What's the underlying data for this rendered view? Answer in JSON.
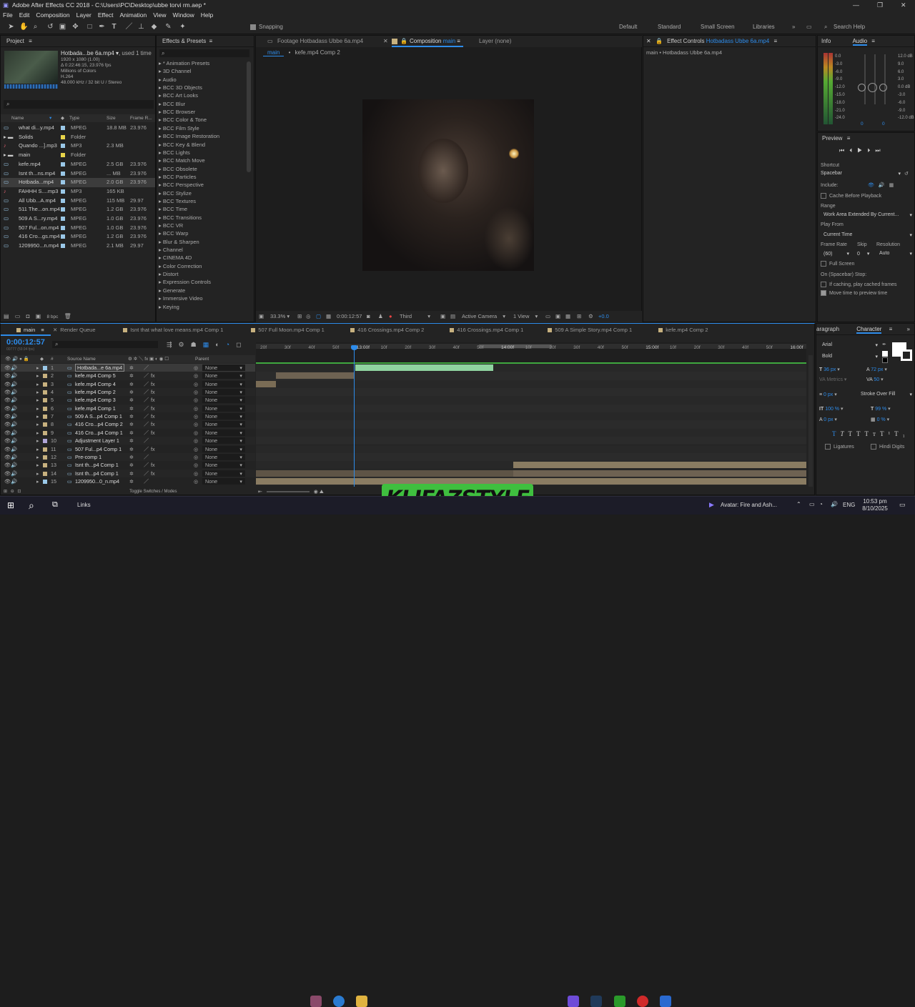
{
  "titlebar": {
    "title": "Adobe After Effects CC 2018 - C:\\Users\\PC\\Desktop\\ubbe torvi rm.aep *",
    "min": "—",
    "max": "❐",
    "close": "✕"
  },
  "menu": [
    "File",
    "Edit",
    "Composition",
    "Layer",
    "Effect",
    "Animation",
    "View",
    "Window",
    "Help"
  ],
  "toolbar": {
    "snapping": "Snapping",
    "workspaces": [
      "Default",
      "Standard",
      "Small Screen",
      "Libraries"
    ],
    "active_ws": "Standard",
    "search_placeholder": "Search Help"
  },
  "project": {
    "title": "Project",
    "info_name": "Hotbada...be 6a.mp4",
    "info_used": ", used 1 time",
    "info_lines": [
      "1920 x 1080 (1.00)",
      "Δ 0:22:46:15, 23.976 fps",
      "Millions of Colors",
      "H.264",
      "48.000 kHz / 32 bit U / Stereo"
    ],
    "search_placeholder": "",
    "columns": {
      "name": "Name",
      "type": "Type",
      "size": "Size",
      "frame": "Frame R..."
    },
    "items": [
      {
        "name": "what di...y.mp4",
        "type": "MPEG",
        "size": "18.8 MB",
        "fr": "23.976",
        "color": "#9ac8e8",
        "icon": "video"
      },
      {
        "name": "Solids",
        "type": "Folder",
        "size": "",
        "fr": "",
        "color": "#e8d44a",
        "icon": "folder"
      },
      {
        "name": "Quando ...].mp3",
        "type": "MP3",
        "size": "2.3 MB",
        "fr": "",
        "color": "#9ac8e8",
        "icon": "audio"
      },
      {
        "name": "main",
        "type": "Folder",
        "size": "",
        "fr": "",
        "color": "#e8d44a",
        "icon": "folder"
      },
      {
        "name": "kefe.mp4",
        "type": "MPEG",
        "size": "2.5 GB",
        "fr": "23.976",
        "color": "#9ac8e8",
        "icon": "video"
      },
      {
        "name": "Isnt th...ns.mp4",
        "type": "MPEG",
        "size": "... MB",
        "fr": "23.976",
        "color": "#9ac8e8",
        "icon": "video"
      },
      {
        "name": "Hotbada...mp4",
        "type": "MPEG",
        "size": "2.0 GB",
        "fr": "23.976",
        "color": "#9ac8e8",
        "icon": "video",
        "selected": true
      },
      {
        "name": "FAHHH S....mp3",
        "type": "MP3",
        "size": "165 KB",
        "fr": "",
        "color": "#9ac8e8",
        "icon": "audio"
      },
      {
        "name": "All Ubb...A.mp4",
        "type": "MPEG",
        "size": "115 MB",
        "fr": "29.97",
        "color": "#9ac8e8",
        "icon": "video"
      },
      {
        "name": "511 The...on.mp4",
        "type": "MPEG",
        "size": "1.2 GB",
        "fr": "23.976",
        "color": "#9ac8e8",
        "icon": "video"
      },
      {
        "name": "509 A S...ry.mp4",
        "type": "MPEG",
        "size": "1.0 GB",
        "fr": "23.976",
        "color": "#9ac8e8",
        "icon": "video"
      },
      {
        "name": "507 Ful...on.mp4",
        "type": "MPEG",
        "size": "1.0 GB",
        "fr": "23.976",
        "color": "#9ac8e8",
        "icon": "video"
      },
      {
        "name": "416 Cro...gs.mp4",
        "type": "MPEG",
        "size": "1.2 GB",
        "fr": "23.976",
        "color": "#9ac8e8",
        "icon": "video"
      },
      {
        "name": "1209950...n.mp4",
        "type": "MPEG",
        "size": "2.1 MB",
        "fr": "29.97",
        "color": "#9ac8e8",
        "icon": "video"
      }
    ],
    "bpc": "8 bpc"
  },
  "effects": {
    "title": "Effects & Presets",
    "search_placeholder": "",
    "items": [
      "* Animation Presets",
      "3D Channel",
      "Audio",
      "BCC 3D Objects",
      "BCC Art Looks",
      "BCC Blur",
      "BCC Browser",
      "BCC Color & Tone",
      "BCC Film Style",
      "BCC Image Restoration",
      "BCC Key & Blend",
      "BCC Lights",
      "BCC Match Move",
      "BCC Obsolete",
      "BCC Particles",
      "BCC Perspective",
      "BCC Stylize",
      "BCC Textures",
      "BCC Time",
      "BCC Transitions",
      "BCC VR",
      "BCC Warp",
      "Blur & Sharpen",
      "Channel",
      "CINEMA 4D",
      "Color Correction",
      "Distort",
      "Expression Controls",
      "Generate",
      "Immersive Video",
      "Keying"
    ]
  },
  "viewer": {
    "tab_footage": "Footage Hotbadass Ubbe 6a.mp4",
    "tab_comp_prefix": "Composition",
    "tab_comp_name": "main",
    "tab_layer": "Layer (none)",
    "sub_main": "main",
    "sub_comp": "kefe.mp4 Comp 2",
    "zoom": "33.3%",
    "time": "0:00:12:57",
    "resolution": "Third",
    "camera": "Active Camera",
    "views": "1 View",
    "exposure": "+0.0"
  },
  "effect_controls": {
    "tab": "Effect Controls",
    "tab_name": "Hotbadass Ubbe 6a.mp4",
    "subtitle": "main • Hotbadass Ubbe 6a.mp4"
  },
  "info_audio": {
    "info_tab": "Info",
    "audio_tab": "Audio",
    "left_db": [
      "0.0",
      "-3.0",
      "-6.0",
      "-9.0",
      "-12.0",
      "-15.0",
      "-18.0",
      "-21.0",
      "-24.0"
    ],
    "right_db": [
      "12.0 dB",
      "9.0",
      "6.0",
      "3.0",
      "0.0 dB",
      "-3.0",
      "-6.0",
      "-9.0",
      "-12.0 dB"
    ],
    "val_left": "0",
    "val_right": "0"
  },
  "preview": {
    "title": "Preview",
    "shortcut_label": "Shortcut",
    "shortcut": "Spacebar",
    "include_label": "Include:",
    "cache": "Cache Before Playback",
    "range_label": "Range",
    "range": "Work Area Extended By Current...",
    "play_from_label": "Play From",
    "play_from": "Current Time",
    "frame_rate_label": "Frame Rate",
    "skip_label": "Skip",
    "resolution_label": "Resolution",
    "frame_rate": "(60)",
    "skip": "0",
    "resolution": "Auto",
    "full_screen": "Full Screen",
    "stop_label": "On (Spacebar) Stop:",
    "cached": "If caching, play cached frames",
    "move_time": "Move time to preview time"
  },
  "timeline": {
    "tabs": [
      "main",
      "Render Queue",
      "Isnt that what love means.mp4 Comp 1",
      "507 Full Moon.mp4 Comp 1",
      "416 Crossings.mp4 Comp 2",
      "416 Crossings.mp4 Comp 1",
      "509 A Simple Story.mp4 Comp 1",
      "kefe.mp4 Comp 2"
    ],
    "timecode": "0:00:12:57",
    "timecode_sub": "00777 (59.94 fps)",
    "col_source": "Source Name",
    "col_parent": "Parent",
    "ruler": [
      "20f",
      "30f",
      "40f",
      "50f",
      "13:00f",
      "10f",
      "20f",
      "30f",
      "40f",
      "50f",
      "14:00f",
      "10f",
      "20f",
      "30f",
      "40f",
      "50f",
      "15:00f",
      "10f",
      "20f",
      "30f",
      "40f",
      "50f",
      "16:00f"
    ],
    "toggle": "Toggle Switches / Modes",
    "layers": [
      {
        "n": "1",
        "name": "Hotbada...e 6a.mp4",
        "color": "#9ac8e8",
        "fx": false,
        "parent": "None",
        "selected": true
      },
      {
        "n": "2",
        "name": "kefe.mp4 Comp 5",
        "color": "#c7b17f",
        "fx": true,
        "parent": "None"
      },
      {
        "n": "3",
        "name": "kefe.mp4 Comp 4",
        "color": "#c7b17f",
        "fx": true,
        "parent": "None"
      },
      {
        "n": "4",
        "name": "kefe.mp4 Comp 2",
        "color": "#c7b17f",
        "fx": true,
        "parent": "None"
      },
      {
        "n": "5",
        "name": "kefe.mp4 Comp 3",
        "color": "#c7b17f",
        "fx": true,
        "parent": "None"
      },
      {
        "n": "6",
        "name": "kefe.mp4 Comp 1",
        "color": "#c7b17f",
        "fx": true,
        "parent": "None"
      },
      {
        "n": "7",
        "name": "509 A S...p4 Comp 1",
        "color": "#c7b17f",
        "fx": true,
        "parent": "None"
      },
      {
        "n": "8",
        "name": "416 Cro...p4 Comp 2",
        "color": "#c7b17f",
        "fx": true,
        "parent": "None"
      },
      {
        "n": "9",
        "name": "416 Cro...p4 Comp 1",
        "color": "#c7b17f",
        "fx": true,
        "parent": "None"
      },
      {
        "n": "10",
        "name": "Adjustment Layer 1",
        "color": "#b0a6d8",
        "fx": false,
        "parent": "None"
      },
      {
        "n": "11",
        "name": "507 Ful...p4 Comp 1",
        "color": "#c7b17f",
        "fx": true,
        "parent": "None"
      },
      {
        "n": "12",
        "name": "Pre-comp 1",
        "color": "#c7b17f",
        "fx": false,
        "parent": "None"
      },
      {
        "n": "13",
        "name": "Isnt th...p4 Comp 1",
        "color": "#c7b17f",
        "fx": true,
        "parent": "None"
      },
      {
        "n": "14",
        "name": "Isnt th...p4 Comp 1",
        "color": "#c7b17f",
        "fx": true,
        "parent": "None"
      },
      {
        "n": "15",
        "name": "1209950...0_n.mp4",
        "color": "#9ac8e8",
        "fx": false,
        "parent": "None"
      }
    ]
  },
  "character": {
    "tab_paragraph": "aragraph",
    "tab_character": "Character",
    "font": "Arial",
    "style": "Bold",
    "size": "36 px",
    "leading": "72 px",
    "kerning": "Metrics",
    "tracking": "50",
    "stroke": "0 px",
    "stroke_type": "Stroke Over Fill",
    "vscale": "100 %",
    "hscale": "99 %",
    "baseline": "0 px",
    "tsume": "0 %",
    "ligatures": "Ligatures",
    "hindi": "Hindi Digits"
  },
  "taskbar": {
    "links": "Links",
    "now_playing": "Avatar: Fire and Ash...",
    "lang": "ENG",
    "time": "10:53 pm",
    "date": "8/10/2025"
  },
  "watermark": "KLIFAZSTYLE",
  "colors": {
    "accent": "#2d8ceb",
    "panel": "#232323",
    "bg": "#1d1d1d",
    "timeline_green": "#3fa83f"
  }
}
